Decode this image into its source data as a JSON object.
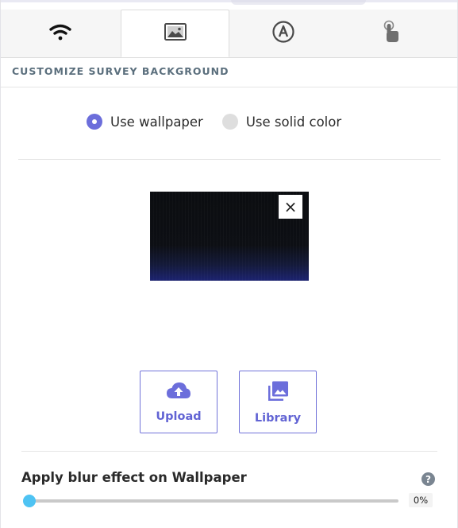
{
  "tabs": [
    {
      "icon": "wifi-icon",
      "active": false
    },
    {
      "icon": "image-icon",
      "active": true
    },
    {
      "icon": "font-a-icon",
      "active": false
    },
    {
      "icon": "touch-hand-icon",
      "active": false
    }
  ],
  "section": {
    "title": "CUSTOMIZE SURVEY BACKGROUND"
  },
  "background_mode": {
    "options": [
      "Use wallpaper",
      "Use solid color"
    ],
    "selected": "Use wallpaper"
  },
  "wallpaper": {
    "remove_symbol": "×"
  },
  "actions": {
    "upload_label": "Upload",
    "library_label": "Library"
  },
  "blur": {
    "label": "Apply blur effect on Wallpaper",
    "value": 0,
    "value_text": "0%",
    "help_symbol": "?"
  },
  "colors": {
    "accent": "#6c6edb",
    "slider_thumb": "#4ec3f3",
    "section_title": "#5b6f7d"
  }
}
